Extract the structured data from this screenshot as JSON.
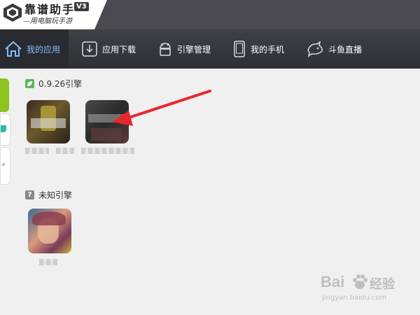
{
  "app": {
    "title": "靠谱助手",
    "version": "V3",
    "subtitle": "—用电脑玩手游"
  },
  "nav": [
    {
      "label": "我的应用",
      "icon": "home-icon",
      "active": true
    },
    {
      "label": "应用下载",
      "icon": "download-icon"
    },
    {
      "label": "引擎管理",
      "icon": "android-icon"
    },
    {
      "label": "我的手机",
      "icon": "phone-icon"
    },
    {
      "label": "斗鱼直播",
      "icon": "shark-icon"
    }
  ],
  "sections": [
    {
      "title": "0.9.26引擎",
      "icon": "leaf-icon",
      "color": "#5cb85c"
    },
    {
      "title": "未知引擎",
      "icon": "question-icon",
      "color": "#888888"
    }
  ],
  "colors": {
    "accent_green": "#8dc21f",
    "nav_active_text": "#7fbfff",
    "arrow_red": "#e8272c"
  },
  "watermark": {
    "brand": "Bai",
    "brand2": "经验",
    "url": "jingyan.baidu.com"
  }
}
